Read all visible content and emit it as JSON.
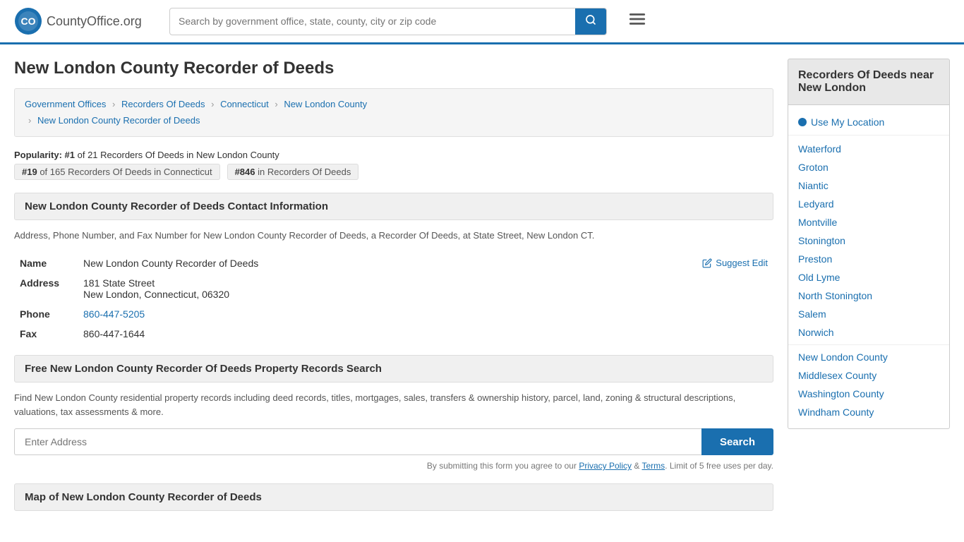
{
  "header": {
    "logo_text": "CountyOffice",
    "logo_suffix": ".org",
    "search_placeholder": "Search by government office, state, county, city or zip code",
    "search_icon": "🔍"
  },
  "breadcrumb": {
    "items": [
      {
        "label": "Government Offices",
        "href": "#"
      },
      {
        "label": "Recorders Of Deeds",
        "href": "#"
      },
      {
        "label": "Connecticut",
        "href": "#"
      },
      {
        "label": "New London County",
        "href": "#"
      },
      {
        "label": "New London County Recorder of Deeds",
        "href": "#"
      }
    ]
  },
  "page_title": "New London County Recorder of Deeds",
  "popularity": {
    "label": "Popularity:",
    "rank1": "#1",
    "rank1_text": "of 21 Recorders Of Deeds in New London County",
    "rank2": "#19",
    "rank2_text": "of 165 Recorders Of Deeds in Connecticut",
    "rank3": "#846",
    "rank3_text": "in Recorders Of Deeds"
  },
  "contact_section": {
    "header": "New London County Recorder of Deeds Contact Information",
    "description": "Address, Phone Number, and Fax Number for New London County Recorder of Deeds, a Recorder Of Deeds, at State Street, New London CT.",
    "fields": {
      "name_label": "Name",
      "name_value": "New London County Recorder of Deeds",
      "address_label": "Address",
      "address_line1": "181 State Street",
      "address_line2": "New London, Connecticut, 06320",
      "phone_label": "Phone",
      "phone_value": "860-447-5205",
      "fax_label": "Fax",
      "fax_value": "860-447-1644"
    },
    "suggest_edit_label": "Suggest Edit"
  },
  "property_section": {
    "header": "Free New London County Recorder Of Deeds Property Records Search",
    "description": "Find New London County residential property records including deed records, titles, mortgages, sales, transfers & ownership history, parcel, land, zoning & structural descriptions, valuations, tax assessments & more.",
    "input_placeholder": "Enter Address",
    "search_button": "Search",
    "disclaimer": "By submitting this form you agree to our",
    "privacy_label": "Privacy Policy",
    "terms_label": "Terms",
    "limit_text": "Limit of 5 free uses per day."
  },
  "map_section": {
    "header": "Map of New London County Recorder of Deeds"
  },
  "sidebar": {
    "header_line1": "Recorders Of Deeds near",
    "header_line2": "New London",
    "use_location": "Use My Location",
    "links": [
      "Waterford",
      "Groton",
      "Niantic",
      "Ledyard",
      "Montville",
      "Stonington",
      "Preston",
      "Old Lyme",
      "North Stonington",
      "Salem",
      "Norwich",
      "New London County",
      "Middlesex County",
      "Washington County",
      "Windham County"
    ]
  }
}
